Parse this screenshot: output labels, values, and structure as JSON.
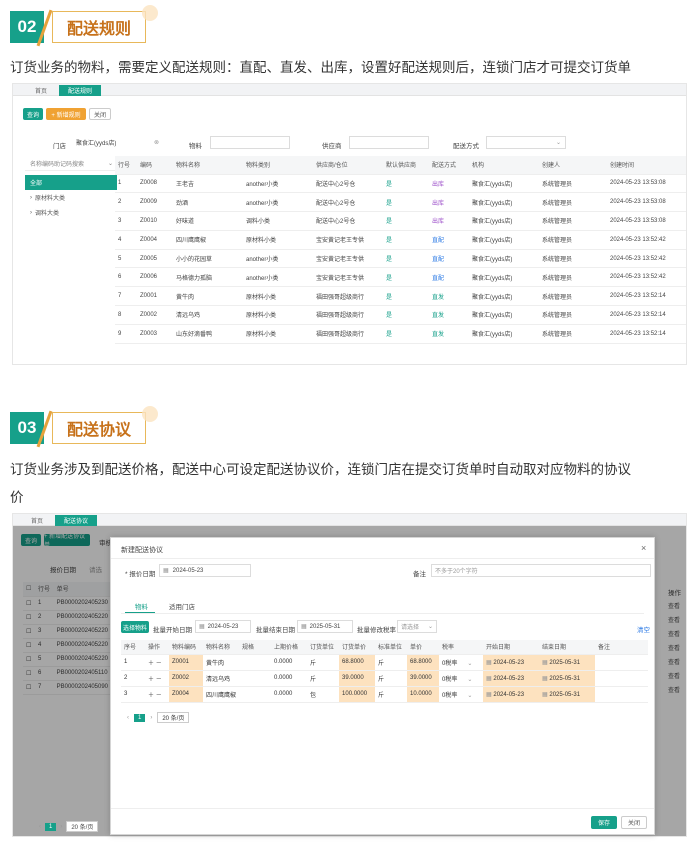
{
  "sec2": {
    "num": "02",
    "title": "配送规则",
    "desc": "订货业务的物料，需要定义配送规则：直配、直发、出库，设置好配送规则后，连锁门店才可提交订货单"
  },
  "sec3": {
    "num": "03",
    "title": "配送协议",
    "desc1": "订货业务涉及到配送价格，配送中心可设定配送协议价，连锁门店在提交订货单时自动取对应物料的协议",
    "desc2": "价"
  },
  "shot1": {
    "tabs": [
      "首页",
      "配送规则"
    ],
    "buttons": {
      "query": "查询",
      "add": "+ 新增规则",
      "close": "关闭"
    },
    "filters": {
      "store_label": "门店",
      "store_value": "聚食汇(yyds店)",
      "material_label": "物料",
      "supplier_label": "供应商",
      "mode_label": "配送方式"
    },
    "side_search_placeholder": "名称编码助记码搜索",
    "side_items": [
      "全部",
      "原材料大类",
      "调料大类"
    ],
    "columns": [
      "行号",
      "编码",
      "物料名称",
      "物料类别",
      "供应商/仓位",
      "默认供应商",
      "配送方式",
      "机构",
      "创建人",
      "创建时间"
    ],
    "rows": [
      [
        "1",
        "Z0008",
        "王老吉",
        "another小类",
        "配送中心2号仓",
        "是",
        "出库",
        "聚食汇(yyds店)",
        "系统管理员",
        "2024-05-23 13:53:08"
      ],
      [
        "2",
        "Z0009",
        "劲酒",
        "another小类",
        "配送中心2号仓",
        "是",
        "出库",
        "聚食汇(yyds店)",
        "系统管理员",
        "2024-05-23 13:53:08"
      ],
      [
        "3",
        "Z0010",
        "好味道",
        "调料小类",
        "配送中心2号仓",
        "是",
        "出库",
        "聚食汇(yyds店)",
        "系统管理员",
        "2024-05-23 13:53:08"
      ],
      [
        "4",
        "Z0004",
        "四川鹰鹰椒",
        "原材料小类",
        "宝安黄记老王专供",
        "是",
        "直配",
        "聚食汇(yyds店)",
        "系统管理员",
        "2024-05-23 13:52:42"
      ],
      [
        "5",
        "Z0005",
        "小小的花园草",
        "another小类",
        "宝安黄记老王专供",
        "是",
        "直配",
        "聚食汇(yyds店)",
        "系统管理员",
        "2024-05-23 13:52:42"
      ],
      [
        "6",
        "Z0006",
        "马格德力孤脑",
        "another小类",
        "宝安黄记老王专供",
        "是",
        "直配",
        "聚食汇(yyds店)",
        "系统管理员",
        "2024-05-23 13:52:42"
      ],
      [
        "7",
        "Z0001",
        "黄牛肉",
        "原材料小类",
        "福田强哥超级商行",
        "是",
        "直发",
        "聚食汇(yyds店)",
        "系统管理员",
        "2024-05-23 13:52:14"
      ],
      [
        "8",
        "Z0002",
        "清远乌鸡",
        "原材料小类",
        "福田强哥超级商行",
        "是",
        "直发",
        "聚食汇(yyds店)",
        "系统管理员",
        "2024-05-23 13:52:14"
      ],
      [
        "9",
        "Z0003",
        "山东好滴番鸭",
        "原材料小类",
        "福田强哥超级商行",
        "是",
        "直发",
        "聚食汇(yyds店)",
        "系统管理员",
        "2024-05-23 13:52:14"
      ]
    ]
  },
  "shot2": {
    "tabs": [
      "首页",
      "配送协议"
    ],
    "buttons": {
      "query": "查询",
      "add": "+ 新增配送协议单",
      "other": "审核"
    },
    "filter_label": "报价日期",
    "filter_value": "请选",
    "bg_columns": [
      "行号",
      "单号"
    ],
    "bg_rows": [
      [
        "1",
        "PB0000202405230"
      ],
      [
        "2",
        "PB0000202405220"
      ],
      [
        "3",
        "PB0000202405220"
      ],
      [
        "4",
        "PB0000202405220"
      ],
      [
        "5",
        "PB0000202405220"
      ],
      [
        "6",
        "PB0000202405110"
      ],
      [
        "7",
        "PB0000202405090"
      ]
    ],
    "op_header": "操作",
    "op_label": "查看",
    "pager": {
      "page": "1",
      "size": "20 条/页"
    },
    "modal": {
      "title": "新建配送协议",
      "date_label": "* 报价日期",
      "date_value": "2024-05-23",
      "remark_label": "备注",
      "remark_placeholder": "不多于20个字符",
      "tabs": [
        "物料",
        "适用门店"
      ],
      "select_btn": "选择物料",
      "batch_start_label": "批量开始日期",
      "batch_start_value": "2024-05-23",
      "batch_end_label": "批量结束日期",
      "batch_end_value": "2025-05-31",
      "batch_tax_label": "批量修改税率",
      "batch_tax_placeholder": "请选择",
      "clear": "清空",
      "columns": [
        "序号",
        "操作",
        "物料编码",
        "物料名称",
        "规格",
        "上期价格",
        "订货单位",
        "订货单价",
        "标准单位",
        "单价",
        "税率",
        "开始日期",
        "结束日期",
        "备注"
      ],
      "rows": [
        [
          "1",
          "Z0001",
          "黄牛肉",
          "",
          "0.0000",
          "斤",
          "68.8000",
          "斤",
          "68.8000",
          "0税率",
          "2024-05-23",
          "2025-05-31",
          ""
        ],
        [
          "2",
          "Z0002",
          "清远乌鸡",
          "",
          "0.0000",
          "斤",
          "39.0000",
          "斤",
          "39.0000",
          "0税率",
          "2024-05-23",
          "2025-05-31",
          ""
        ],
        [
          "3",
          "Z0004",
          "四川鹰鹰椒",
          "",
          "0.0000",
          "包",
          "100.0000",
          "斤",
          "10.0000",
          "0税率",
          "2024-05-23",
          "2025-05-31",
          ""
        ]
      ],
      "pager": {
        "page": "1",
        "size": "20 条/页"
      },
      "save": "保存",
      "close": "关闭"
    }
  },
  "colors": {
    "green": "#16a08a",
    "orange": "#f0a233",
    "highlight": "#fde2bf"
  }
}
